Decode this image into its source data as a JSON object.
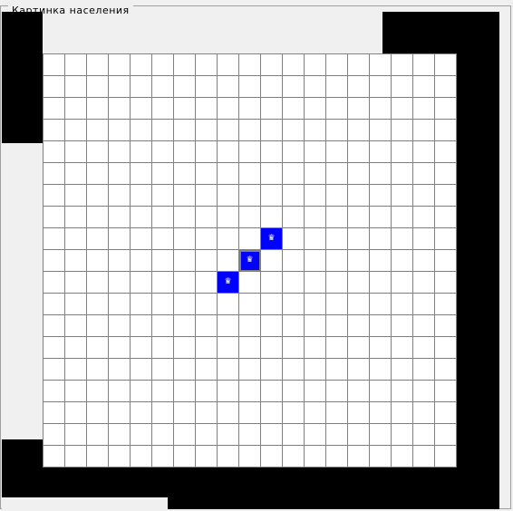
{
  "window": {
    "group_title": "Картинка  населения"
  },
  "grid": {
    "rows": 19,
    "cols": 19,
    "populated": [
      {
        "row": 8,
        "col": 10,
        "icon": "person-icon",
        "selected": false
      },
      {
        "row": 9,
        "col": 9,
        "icon": "person-icon",
        "selected": true
      },
      {
        "row": 10,
        "col": 8,
        "icon": "person-icon",
        "selected": false
      }
    ],
    "cell_color": "#ffffff",
    "line_color": "#808080",
    "population_color": "#0000ff"
  },
  "person_glyph": "♛"
}
